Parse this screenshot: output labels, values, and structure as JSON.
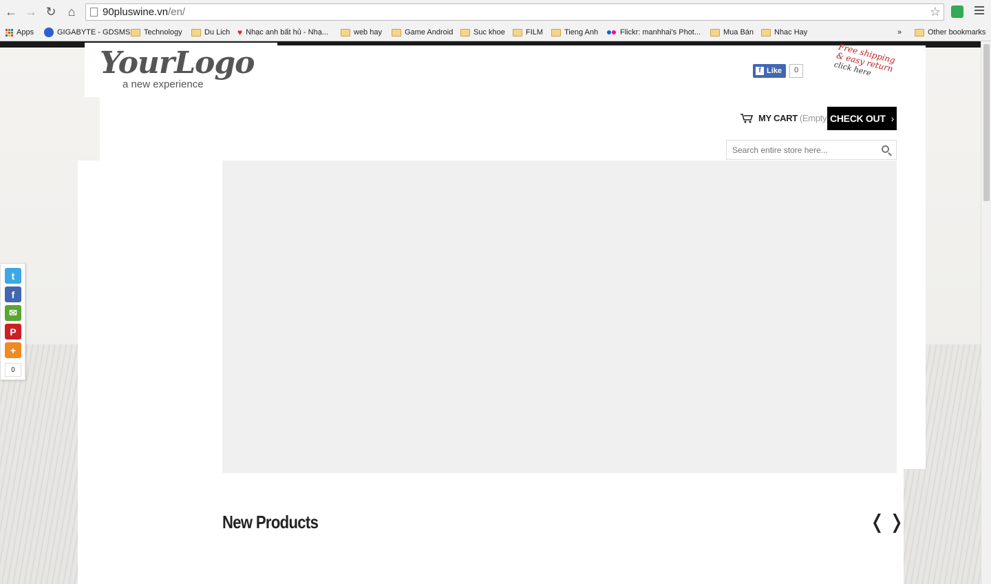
{
  "browser": {
    "url_host": "90pluswine.vn",
    "url_path": "/en/",
    "bookmarks": [
      {
        "label": "Apps",
        "icon": "apps-grid-icon"
      },
      {
        "label": "GIGABYTE - GDSMS",
        "icon": "gigabyte-icon"
      },
      {
        "label": "Technology",
        "icon": "folder-icon"
      },
      {
        "label": "Du Lich",
        "icon": "folder-icon"
      },
      {
        "label": "Nhạc anh bất hủ - Nhạ...",
        "icon": "heart-icon"
      },
      {
        "label": "web hay",
        "icon": "folder-icon"
      },
      {
        "label": "Game Android",
        "icon": "folder-icon"
      },
      {
        "label": "Suc khoe",
        "icon": "folder-icon"
      },
      {
        "label": "FILM",
        "icon": "folder-icon"
      },
      {
        "label": "Tieng Anh",
        "icon": "folder-icon"
      },
      {
        "label": "Flickr: manhhai's Phot...",
        "icon": "flickr-icon"
      },
      {
        "label": "Mua Bán",
        "icon": "folder-icon"
      },
      {
        "label": "Nhac Hay",
        "icon": "folder-icon"
      }
    ],
    "overflow_label": "»",
    "other_bookmarks": "Other bookmarks"
  },
  "header": {
    "logo_main": "YourLogo",
    "logo_tagline": "a new experience",
    "fb_like_label": "Like",
    "fb_like_count": "0",
    "promo_line1": "Free shipping",
    "promo_line2": "& easy return",
    "promo_click": "click here",
    "cart_label": "MY CART",
    "cart_status": "(Empty)",
    "checkout_label": "CHECK OUT",
    "search_placeholder": "Search entire store here..."
  },
  "main": {
    "section_title": "New Products",
    "prev_arrow": "❬",
    "next_arrow": "❭"
  },
  "share": {
    "count": "0",
    "buttons": [
      "twitter",
      "facebook",
      "email",
      "pinterest",
      "more"
    ]
  },
  "colors": {
    "facebook": "#4267b2",
    "twitter": "#3ea8e6",
    "email": "#5aa632",
    "pinterest": "#cb2027",
    "more": "#f08a24"
  }
}
